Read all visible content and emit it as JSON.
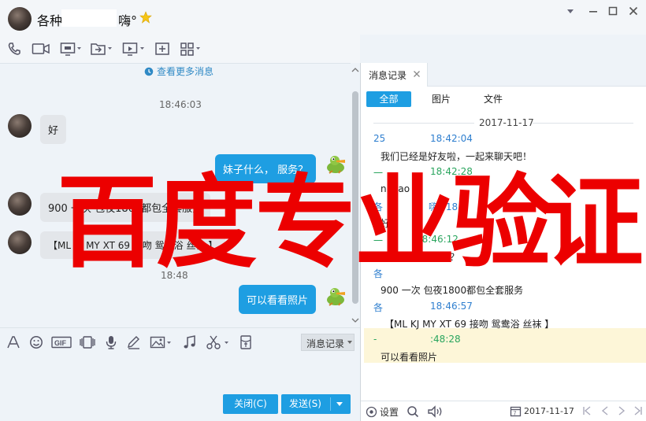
{
  "window": {
    "contact_name": "各种",
    "contact_suffix": "嗨°",
    "controls": [
      "chevron-down-icon",
      "minimize-icon",
      "maximize-icon",
      "close-icon"
    ]
  },
  "toolbar": {
    "icons": [
      "phone-icon",
      "video-camera-icon",
      "screen-share-icon",
      "file-transfer-icon",
      "remote-desktop-icon",
      "add-app-icon",
      "apps-grid-icon"
    ]
  },
  "chat": {
    "more_messages": "查看更多消息",
    "time_1": "18:46:03",
    "time_2": "18:48",
    "messages": [
      {
        "side": "in",
        "text": "好"
      },
      {
        "side": "out",
        "text": "妹子什么， 服务？"
      },
      {
        "side": "in",
        "text": "900 一次 包夜1800都包全套服务"
      },
      {
        "side": "in",
        "text": "【ML  KJ  MY  XT   69  接吻 鸳鸯浴 丝袜 】"
      },
      {
        "side": "out",
        "text": "可以看看照片"
      }
    ]
  },
  "input_toolbar": {
    "icons": [
      "font-icon",
      "emoji-icon",
      "gif-icon",
      "shake-icon",
      "microphone-icon",
      "edit-icon",
      "image-icon",
      "music-icon",
      "scissors-icon",
      "red-packet-icon"
    ],
    "history_button": "消息记录"
  },
  "buttons": {
    "close": "关闭(C)",
    "send": "发送(S)"
  },
  "history_panel": {
    "tab": "消息记录",
    "filters": [
      "全部",
      "图片",
      "文件"
    ],
    "date": "2017-11-17",
    "entries": [
      {
        "meta": "25",
        "meta_tail": "18:42:04",
        "color": "blue",
        "text": "我们已经是好友啦，一起来聊天吧！"
      },
      {
        "meta": "一",
        "meta_tail": "18:42:28",
        "color": "green",
        "text": "ni hao"
      },
      {
        "meta": "各",
        "meta_tail": "嗨° 18:4",
        "color": "blue",
        "text": "好"
      },
      {
        "meta": "一",
        "meta_tail": "18:46:12",
        "color": "green",
        "text": "妹子什么， 服务？"
      },
      {
        "meta": "各",
        "meta_tail": "",
        "color": "blue",
        "text": "900 一次 包夜1800都包全套服务"
      },
      {
        "meta": "各",
        "meta_tail": "18:46:57",
        "color": "blue",
        "text": "【ML  KJ  MY  XT   69  接吻 鸳鸯浴 丝袜 】"
      },
      {
        "meta": "-",
        "meta_tail": ":48:28",
        "color": "green",
        "text": "可以看看照片"
      }
    ],
    "bottom": {
      "settings": "设置",
      "date": "2017-11-17"
    }
  },
  "watermark": {
    "text": [
      "百",
      "度",
      "专",
      "业",
      "验",
      "证"
    ],
    "color": "#ec0000"
  },
  "colors": {
    "accent": "#1e9ee2",
    "panel_bg": "#eef3f8"
  }
}
